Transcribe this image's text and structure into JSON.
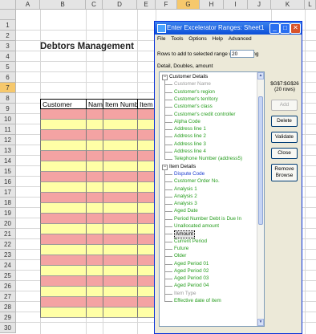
{
  "sheet": {
    "columns": [
      "A",
      "B",
      "C",
      "D",
      "E",
      "F",
      "G",
      "H",
      "I",
      "J",
      "K",
      "L"
    ],
    "rows": [
      "1",
      "2",
      "3",
      "4",
      "5",
      "6",
      "7",
      "8",
      "9",
      "10",
      "11",
      "12",
      "13",
      "14",
      "15",
      "16",
      "17",
      "18",
      "19",
      "20",
      "21",
      "22",
      "23",
      "24",
      "25",
      "26",
      "27",
      "28",
      "29",
      "30"
    ],
    "active_column": "G",
    "active_row": "7",
    "title": "Debtors Management",
    "headers": [
      "Customer",
      "Name",
      "Item Number",
      "Item T"
    ]
  },
  "dialog": {
    "title": "Enter Excelerator Ranges: Sheet1",
    "menu": [
      "File",
      "Tools",
      "Options",
      "Help",
      "Advanced"
    ],
    "rows_label": "Rows to add to selected range when adding",
    "rows_value": "20",
    "mode_label": "Detail, Doubles, amount",
    "range_count": "$G$7:$G$26",
    "range_rows": "(20 rows)",
    "buttons": {
      "add": "Add",
      "delete": "Delete",
      "validate": "Validate",
      "close": "Close",
      "remove_browse": "Remove Browse"
    },
    "tree": {
      "group1": "Customer Details",
      "group1_items": [
        {
          "label": "Customer Name",
          "tone": "gray"
        },
        {
          "label": "Customer's region",
          "tone": "green"
        },
        {
          "label": "Customer's territory",
          "tone": "green"
        },
        {
          "label": "Customer's class",
          "tone": "green"
        },
        {
          "label": "Customer's credit controller",
          "tone": "green"
        },
        {
          "label": "Alpha Code",
          "tone": "green"
        },
        {
          "label": "Address line 1",
          "tone": "green"
        },
        {
          "label": "Address line 2",
          "tone": "green"
        },
        {
          "label": "Address line 3",
          "tone": "green"
        },
        {
          "label": "Address line 4",
          "tone": "green"
        },
        {
          "label": "Telephone Number (address5)",
          "tone": "green"
        }
      ],
      "group2": "Item Details",
      "group2_items": [
        {
          "label": "Dispute Code",
          "tone": "blue"
        },
        {
          "label": "Customer Order No.",
          "tone": "green"
        },
        {
          "label": "Analysis 1",
          "tone": "green"
        },
        {
          "label": "Analysis 2",
          "tone": "green"
        },
        {
          "label": "Analysis 3",
          "tone": "green"
        },
        {
          "label": "Aged Date",
          "tone": "green"
        },
        {
          "label": "Period Number Debt is Due In",
          "tone": "green"
        },
        {
          "label": "Unallocated amount",
          "tone": "green"
        },
        {
          "label": "Amount",
          "tone": "selected"
        },
        {
          "label": "Current Period",
          "tone": "green"
        },
        {
          "label": "Future",
          "tone": "green"
        },
        {
          "label": "Older",
          "tone": "green"
        },
        {
          "label": "Aged Period 01",
          "tone": "green"
        },
        {
          "label": "Aged Period 02",
          "tone": "green"
        },
        {
          "label": "Aged Period 03",
          "tone": "green"
        },
        {
          "label": "Aged Period 04",
          "tone": "green"
        },
        {
          "label": "Item Type",
          "tone": "gray"
        },
        {
          "label": "Effective date of item",
          "tone": "green"
        }
      ]
    }
  },
  "colors": {
    "pink": "#f4a3a3",
    "yellow": "#ffffa6",
    "active_header": "#f6c86c",
    "titlebar": "#0b4fd8"
  }
}
